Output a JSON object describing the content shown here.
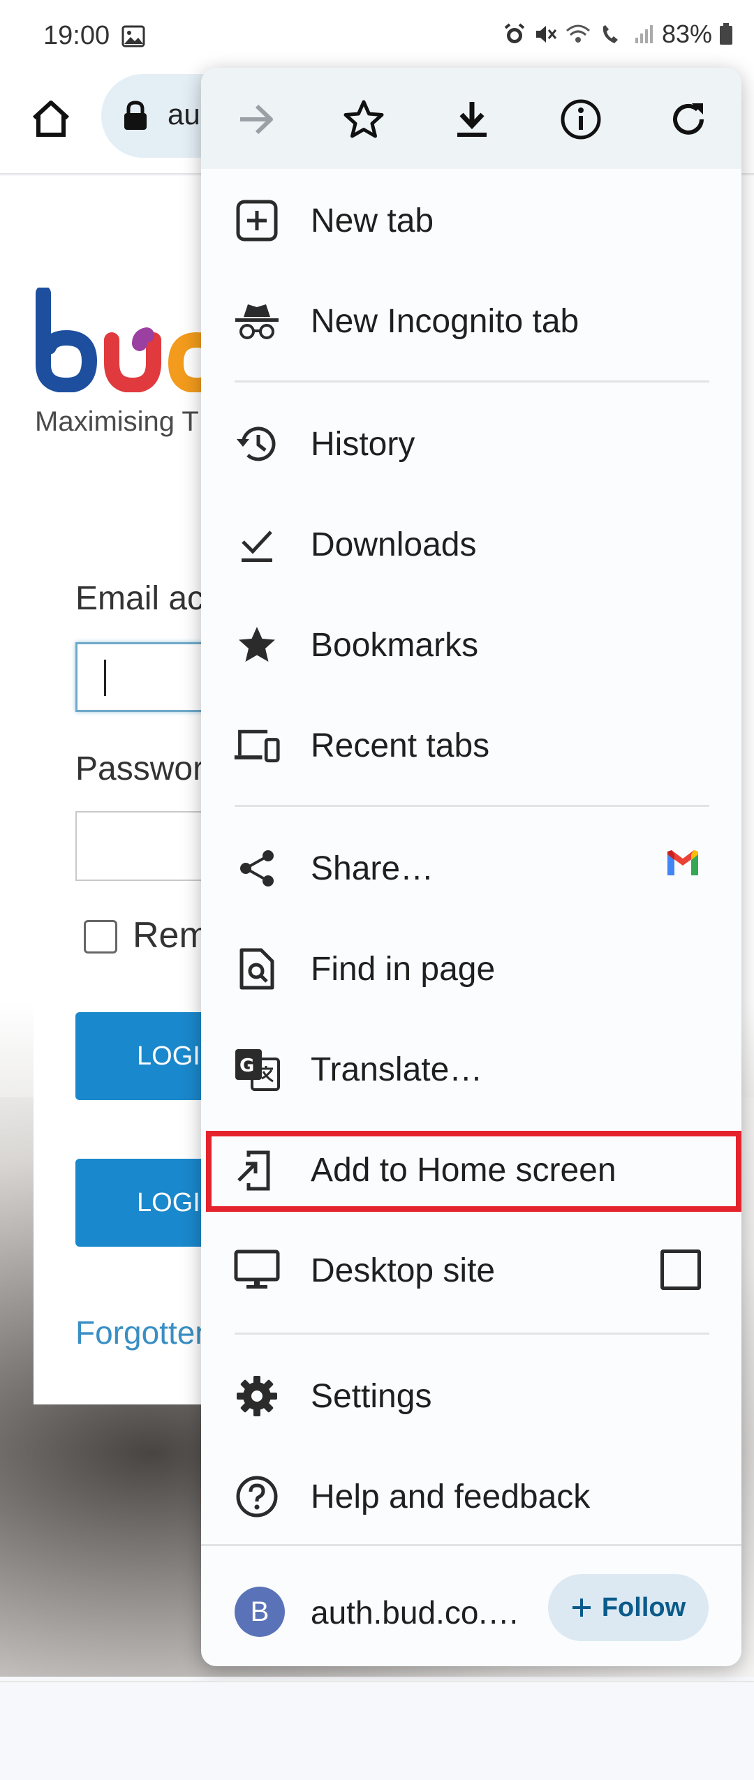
{
  "status_bar": {
    "time": "19:00",
    "battery": "83%"
  },
  "toolbar": {
    "url_fragment": "au"
  },
  "page": {
    "tagline": "Maximising T",
    "email_label": "Email ac",
    "password_label": "Passwor",
    "remember_label": "Rem",
    "login_label_1": "LOGII",
    "login_label_2": "LOGII",
    "forgotten_link": "Forgotten"
  },
  "menu": {
    "top_icons": [
      "forward-icon",
      "bookmark-star-icon",
      "download-icon",
      "info-icon",
      "refresh-icon"
    ],
    "items": [
      {
        "label": "New tab",
        "icon": "new-tab-icon"
      },
      {
        "label": "New Incognito tab",
        "icon": "incognito-icon"
      },
      {
        "label": "History",
        "icon": "history-icon"
      },
      {
        "label": "Downloads",
        "icon": "downloads-icon"
      },
      {
        "label": "Bookmarks",
        "icon": "bookmarks-icon"
      },
      {
        "label": "Recent tabs",
        "icon": "recent-tabs-icon"
      },
      {
        "label": "Share…",
        "icon": "share-icon"
      },
      {
        "label": "Find in page",
        "icon": "find-in-page-icon"
      },
      {
        "label": "Translate…",
        "icon": "translate-icon"
      },
      {
        "label": "Add to Home screen",
        "icon": "add-to-home-icon"
      },
      {
        "label": "Desktop site",
        "icon": "desktop-icon"
      },
      {
        "label": "Settings",
        "icon": "settings-icon"
      },
      {
        "label": "Help and feedback",
        "icon": "help-icon"
      }
    ],
    "site": {
      "avatar_letter": "B",
      "name": "auth.bud.co.…",
      "follow_label": "Follow"
    }
  },
  "colors": {
    "highlight": "#e5232d",
    "follow_bg": "#dce9f2",
    "login_blue": "#1a88cc"
  }
}
